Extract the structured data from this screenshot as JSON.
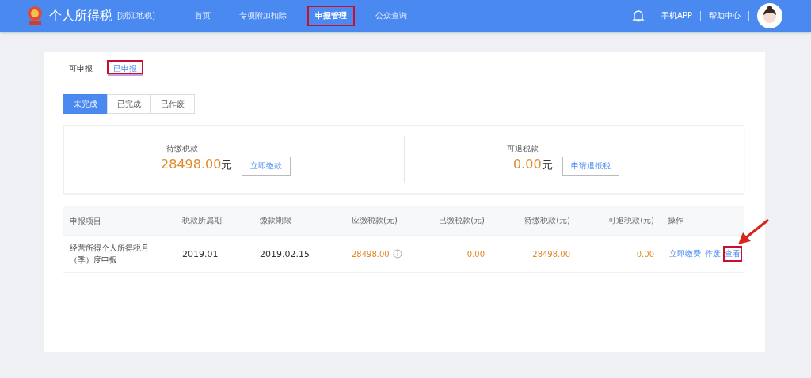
{
  "header": {
    "title": "个人所得税",
    "region": "[浙江地税]",
    "nav": [
      {
        "label": "首页",
        "selected": false,
        "highlighted": false
      },
      {
        "label": "专项附加扣除",
        "selected": false,
        "highlighted": false
      },
      {
        "label": "申报管理",
        "selected": true,
        "highlighted": true
      },
      {
        "label": "公众查询",
        "selected": false,
        "highlighted": false
      }
    ],
    "links": [
      "手机APP",
      "帮助中心"
    ]
  },
  "tabs": [
    {
      "label": "可申报",
      "selected": false,
      "highlighted": false
    },
    {
      "label": "已申报",
      "selected": true,
      "highlighted": true
    }
  ],
  "filters": [
    {
      "label": "未完成",
      "selected": true
    },
    {
      "label": "已完成",
      "selected": false
    },
    {
      "label": "已作废",
      "selected": false
    }
  ],
  "summary": [
    {
      "label": "待缴税款",
      "amount": "28498.00",
      "unit": "元",
      "button": "立即缴款"
    },
    {
      "label": "可退税款",
      "amount": "0.00",
      "unit": "元",
      "button": "申请退抵税"
    }
  ],
  "table": {
    "columns": [
      "申报项目",
      "税款所属期",
      "缴款期限",
      "应缴税款(元)",
      "已缴税款(元)",
      "待缴税款(元)",
      "可退税款(元)",
      "操作"
    ],
    "rows": [
      {
        "item": "经营所得个人所得税月（季）度申报",
        "period": "2019.01",
        "deadline": "2019.02.15",
        "due": "28498.00",
        "paid": "0.00",
        "pending": "28498.00",
        "refund": "0.00",
        "actions": [
          {
            "label": "立即缴费",
            "highlighted": false
          },
          {
            "label": "作废",
            "highlighted": false
          },
          {
            "label": "查看",
            "highlighted": true
          }
        ]
      }
    ]
  }
}
